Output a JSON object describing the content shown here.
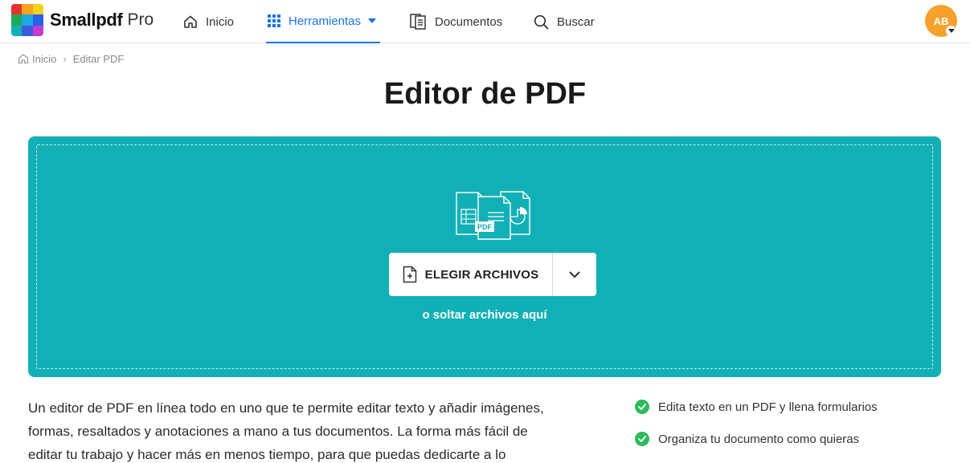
{
  "header": {
    "brand": "Smallpdf",
    "brand_suffix": "Pro",
    "nav": {
      "home": "Inicio",
      "tools": "Herramientas",
      "documents": "Documentos",
      "search": "Buscar"
    },
    "avatar_initials": "AB"
  },
  "colors": {
    "accent": "#1a73e8",
    "dropzone": "#11b0b6",
    "avatar": "#f7a02c",
    "check": "#2dbb5d"
  },
  "breadcrumb": {
    "home": "Inicio",
    "separator": "›",
    "current": "Editar PDF"
  },
  "main": {
    "title": "Editor de PDF",
    "choose_label": "ELEGIR ARCHIVOS",
    "drop_hint": "o soltar archivos aquí",
    "pdf_badge": "PDF",
    "description": "Un editor de PDF en línea todo en uno que te permite editar texto y añadir imágenes, formas, resaltados y anotaciones a mano a tus documentos. La forma más fácil de editar tu trabajo y hacer más en menos tiempo, para que puedas dedicarte a lo",
    "features": [
      "Edita texto en un PDF y llena formularios",
      "Organiza tu documento como quieras"
    ]
  },
  "icons": [
    "home-icon",
    "grid-icon",
    "documents-icon",
    "search-icon",
    "file-plus-icon",
    "chevron-down-icon",
    "check-icon",
    "files-illustration"
  ]
}
